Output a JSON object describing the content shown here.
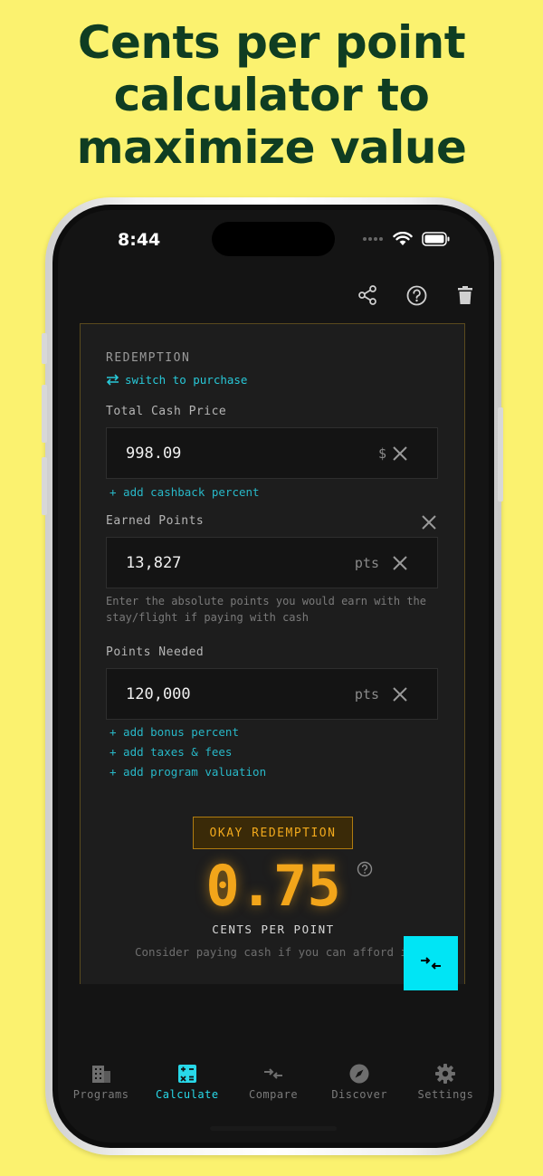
{
  "headline": {
    "line1": "Cents per point",
    "line2": "calculator to",
    "line3": "maximize value"
  },
  "status_bar": {
    "time": "8:44"
  },
  "toolbar": {
    "icons": [
      "share-icon",
      "help-circle-icon",
      "trash-icon"
    ]
  },
  "card": {
    "section_title": "REDEMPTION",
    "switch_label": "switch to purchase",
    "cash_price": {
      "label": "Total Cash Price",
      "value": "998.09",
      "unit": "$"
    },
    "add_cashback": "+ add cashback percent",
    "earned_points": {
      "label": "Earned Points",
      "value": "13,827",
      "unit": "pts",
      "helper": "Enter the absolute points you would earn with the stay/flight if paying with cash"
    },
    "points_needed": {
      "label": "Points Needed",
      "value": "120,000",
      "unit": "pts"
    },
    "add_links": [
      "+ add bonus percent",
      "+ add taxes & fees",
      "+ add program valuation"
    ],
    "result": {
      "badge": "OKAY REDEMPTION",
      "value": "0.75",
      "unit_label": "CENTS PER POINT",
      "advice": "Consider paying cash if you can afford it"
    }
  },
  "tabbar": {
    "tabs": [
      {
        "label": "Programs",
        "icon": "building-icon",
        "active": false
      },
      {
        "label": "Calculate",
        "icon": "calculator-icon",
        "active": true
      },
      {
        "label": "Compare",
        "icon": "compare-arrows-icon",
        "active": false
      },
      {
        "label": "Discover",
        "icon": "compass-icon",
        "active": false
      },
      {
        "label": "Settings",
        "icon": "gear-icon",
        "active": false
      }
    ]
  },
  "colors": {
    "background": "#fbf26f",
    "headline": "#0f3d22",
    "accent_cyan": "#00e5f5",
    "accent_orange": "#f2a51a"
  }
}
